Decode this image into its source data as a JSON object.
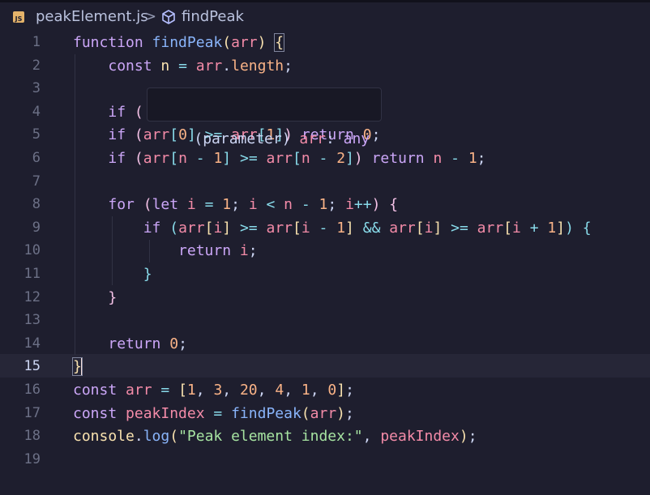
{
  "breadcrumb": {
    "file_badge": "JS",
    "file": "peakElement.js",
    "separator": ">",
    "symbol": "findPeak"
  },
  "hover": {
    "label": "(parameter)",
    "name": "arr",
    "colon": ":",
    "type": "any"
  },
  "current_line": 15,
  "lines": [
    {
      "num": "1",
      "tokens": [
        {
          "t": "function",
          "c": "kw"
        },
        {
          "t": " ",
          "c": "tx"
        },
        {
          "t": "findPeak",
          "c": "fn"
        },
        {
          "t": "(",
          "c": "bl"
        },
        {
          "t": "arr",
          "c": "vr"
        },
        {
          "t": ")",
          "c": "bl"
        },
        {
          "t": " ",
          "c": "tx"
        },
        {
          "t": "{",
          "c": "bl",
          "m": 1
        }
      ]
    },
    {
      "num": "2",
      "tokens": [
        {
          "t": "    ",
          "c": "tx"
        },
        {
          "t": "const",
          "c": "kw"
        },
        {
          "t": " ",
          "c": "tx"
        },
        {
          "t": "n",
          "c": "pr"
        },
        {
          "t": " = ",
          "c": "op"
        },
        {
          "t": "arr",
          "c": "vr"
        },
        {
          "t": ".",
          "c": "tx"
        },
        {
          "t": "length",
          "c": "nm"
        },
        {
          "t": ";",
          "c": "tx"
        }
      ]
    },
    {
      "num": "3",
      "tokens": []
    },
    {
      "num": "4",
      "tokens": [
        {
          "t": "    ",
          "c": "tx"
        },
        {
          "t": "if",
          "c": "kw"
        },
        {
          "t": " ",
          "c": "tx"
        },
        {
          "t": "(",
          "c": "bp"
        }
      ]
    },
    {
      "num": "5",
      "tokens": [
        {
          "t": "    ",
          "c": "tx"
        },
        {
          "t": "if",
          "c": "kw"
        },
        {
          "t": " ",
          "c": "tx"
        },
        {
          "t": "(",
          "c": "bp"
        },
        {
          "t": "arr",
          "c": "vr"
        },
        {
          "t": "[",
          "c": "bc"
        },
        {
          "t": "0",
          "c": "nm"
        },
        {
          "t": "]",
          "c": "bc"
        },
        {
          "t": " >= ",
          "c": "op"
        },
        {
          "t": "arr",
          "c": "vr"
        },
        {
          "t": "[",
          "c": "bc"
        },
        {
          "t": "1",
          "c": "nm"
        },
        {
          "t": "]",
          "c": "bc"
        },
        {
          "t": ")",
          "c": "bp"
        },
        {
          "t": " ",
          "c": "tx"
        },
        {
          "t": "return",
          "c": "kw"
        },
        {
          "t": " ",
          "c": "tx"
        },
        {
          "t": "0",
          "c": "nm"
        },
        {
          "t": ";",
          "c": "tx"
        }
      ]
    },
    {
      "num": "6",
      "tokens": [
        {
          "t": "    ",
          "c": "tx"
        },
        {
          "t": "if",
          "c": "kw"
        },
        {
          "t": " ",
          "c": "tx"
        },
        {
          "t": "(",
          "c": "bp"
        },
        {
          "t": "arr",
          "c": "vr"
        },
        {
          "t": "[",
          "c": "bc"
        },
        {
          "t": "n",
          "c": "vr"
        },
        {
          "t": " - ",
          "c": "op"
        },
        {
          "t": "1",
          "c": "nm"
        },
        {
          "t": "]",
          "c": "bc"
        },
        {
          "t": " >= ",
          "c": "op"
        },
        {
          "t": "arr",
          "c": "vr"
        },
        {
          "t": "[",
          "c": "bc"
        },
        {
          "t": "n",
          "c": "vr"
        },
        {
          "t": " - ",
          "c": "op"
        },
        {
          "t": "2",
          "c": "nm"
        },
        {
          "t": "]",
          "c": "bc"
        },
        {
          "t": ")",
          "c": "bp"
        },
        {
          "t": " ",
          "c": "tx"
        },
        {
          "t": "return",
          "c": "kw"
        },
        {
          "t": " ",
          "c": "tx"
        },
        {
          "t": "n",
          "c": "vr"
        },
        {
          "t": " - ",
          "c": "op"
        },
        {
          "t": "1",
          "c": "nm"
        },
        {
          "t": ";",
          "c": "tx"
        }
      ]
    },
    {
      "num": "7",
      "tokens": []
    },
    {
      "num": "8",
      "tokens": [
        {
          "t": "    ",
          "c": "tx"
        },
        {
          "t": "for",
          "c": "kw"
        },
        {
          "t": " ",
          "c": "tx"
        },
        {
          "t": "(",
          "c": "bp"
        },
        {
          "t": "let",
          "c": "kw"
        },
        {
          "t": " ",
          "c": "tx"
        },
        {
          "t": "i",
          "c": "vr"
        },
        {
          "t": " = ",
          "c": "op"
        },
        {
          "t": "1",
          "c": "nm"
        },
        {
          "t": "; ",
          "c": "tx"
        },
        {
          "t": "i",
          "c": "vr"
        },
        {
          "t": " < ",
          "c": "op"
        },
        {
          "t": "n",
          "c": "vr"
        },
        {
          "t": " - ",
          "c": "op"
        },
        {
          "t": "1",
          "c": "nm"
        },
        {
          "t": "; ",
          "c": "tx"
        },
        {
          "t": "i",
          "c": "vr"
        },
        {
          "t": "++",
          "c": "op"
        },
        {
          "t": ")",
          "c": "bp"
        },
        {
          "t": " ",
          "c": "tx"
        },
        {
          "t": "{",
          "c": "bp"
        }
      ]
    },
    {
      "num": "9",
      "tokens": [
        {
          "t": "        ",
          "c": "tx"
        },
        {
          "t": "if",
          "c": "kw"
        },
        {
          "t": " ",
          "c": "tx"
        },
        {
          "t": "(",
          "c": "bc"
        },
        {
          "t": "arr",
          "c": "vr"
        },
        {
          "t": "[",
          "c": "bl"
        },
        {
          "t": "i",
          "c": "vr"
        },
        {
          "t": "]",
          "c": "bl"
        },
        {
          "t": " >= ",
          "c": "op"
        },
        {
          "t": "arr",
          "c": "vr"
        },
        {
          "t": "[",
          "c": "bl"
        },
        {
          "t": "i",
          "c": "vr"
        },
        {
          "t": " - ",
          "c": "op"
        },
        {
          "t": "1",
          "c": "nm"
        },
        {
          "t": "]",
          "c": "bl"
        },
        {
          "t": " && ",
          "c": "op"
        },
        {
          "t": "arr",
          "c": "vr"
        },
        {
          "t": "[",
          "c": "bl"
        },
        {
          "t": "i",
          "c": "vr"
        },
        {
          "t": "]",
          "c": "bl"
        },
        {
          "t": " >= ",
          "c": "op"
        },
        {
          "t": "arr",
          "c": "vr"
        },
        {
          "t": "[",
          "c": "bl"
        },
        {
          "t": "i",
          "c": "vr"
        },
        {
          "t": " + ",
          "c": "op"
        },
        {
          "t": "1",
          "c": "nm"
        },
        {
          "t": "]",
          "c": "bl"
        },
        {
          "t": ")",
          "c": "bc"
        },
        {
          "t": " ",
          "c": "tx"
        },
        {
          "t": "{",
          "c": "bc"
        }
      ]
    },
    {
      "num": "10",
      "tokens": [
        {
          "t": "            ",
          "c": "tx"
        },
        {
          "t": "return",
          "c": "kw"
        },
        {
          "t": " ",
          "c": "tx"
        },
        {
          "t": "i",
          "c": "vr"
        },
        {
          "t": ";",
          "c": "tx"
        }
      ]
    },
    {
      "num": "11",
      "tokens": [
        {
          "t": "        ",
          "c": "tx"
        },
        {
          "t": "}",
          "c": "bc"
        }
      ]
    },
    {
      "num": "12",
      "tokens": [
        {
          "t": "    ",
          "c": "tx"
        },
        {
          "t": "}",
          "c": "bp"
        }
      ]
    },
    {
      "num": "13",
      "tokens": []
    },
    {
      "num": "14",
      "tokens": [
        {
          "t": "    ",
          "c": "tx"
        },
        {
          "t": "return",
          "c": "kw"
        },
        {
          "t": " ",
          "c": "tx"
        },
        {
          "t": "0",
          "c": "nm"
        },
        {
          "t": ";",
          "c": "tx"
        }
      ]
    },
    {
      "num": "15",
      "tokens": [
        {
          "t": "}",
          "c": "bl",
          "m": 1,
          "cursor": 1
        }
      ]
    },
    {
      "num": "16",
      "tokens": [
        {
          "t": "const",
          "c": "kw"
        },
        {
          "t": " ",
          "c": "tx"
        },
        {
          "t": "arr",
          "c": "vr"
        },
        {
          "t": " = ",
          "c": "op"
        },
        {
          "t": "[",
          "c": "bl"
        },
        {
          "t": "1",
          "c": "nm"
        },
        {
          "t": ", ",
          "c": "tx"
        },
        {
          "t": "3",
          "c": "nm"
        },
        {
          "t": ", ",
          "c": "tx"
        },
        {
          "t": "20",
          "c": "nm"
        },
        {
          "t": ", ",
          "c": "tx"
        },
        {
          "t": "4",
          "c": "nm"
        },
        {
          "t": ", ",
          "c": "tx"
        },
        {
          "t": "1",
          "c": "nm"
        },
        {
          "t": ", ",
          "c": "tx"
        },
        {
          "t": "0",
          "c": "nm"
        },
        {
          "t": "]",
          "c": "bl"
        },
        {
          "t": ";",
          "c": "tx"
        }
      ]
    },
    {
      "num": "17",
      "tokens": [
        {
          "t": "const",
          "c": "kw"
        },
        {
          "t": " ",
          "c": "tx"
        },
        {
          "t": "peakIndex",
          "c": "vr"
        },
        {
          "t": " = ",
          "c": "op"
        },
        {
          "t": "findPeak",
          "c": "fn"
        },
        {
          "t": "(",
          "c": "bl"
        },
        {
          "t": "arr",
          "c": "vr"
        },
        {
          "t": ")",
          "c": "bl"
        },
        {
          "t": ";",
          "c": "tx"
        }
      ]
    },
    {
      "num": "18",
      "tokens": [
        {
          "t": "console",
          "c": "pr"
        },
        {
          "t": ".",
          "c": "tx"
        },
        {
          "t": "log",
          "c": "fn"
        },
        {
          "t": "(",
          "c": "bl"
        },
        {
          "t": "\"Peak element index:\"",
          "c": "st"
        },
        {
          "t": ", ",
          "c": "tx"
        },
        {
          "t": "peakIndex",
          "c": "vr"
        },
        {
          "t": ")",
          "c": "bl"
        },
        {
          "t": ";",
          "c": "tx"
        }
      ]
    },
    {
      "num": "19",
      "tokens": []
    }
  ]
}
